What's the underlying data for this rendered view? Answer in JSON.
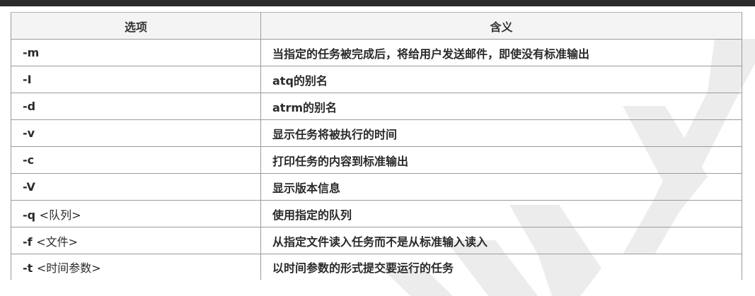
{
  "table": {
    "headers": [
      "选项",
      "含义"
    ],
    "rows": [
      {
        "option": "-m",
        "arg": "",
        "meaning": "当指定的任务被完成后，将给用户发送邮件，即使没有标准输出"
      },
      {
        "option": "-I",
        "arg": "",
        "meaning": "atq的别名"
      },
      {
        "option": "-d",
        "arg": "",
        "meaning": "atrm的别名"
      },
      {
        "option": "-v",
        "arg": "",
        "meaning": "显示任务将被执行的时间"
      },
      {
        "option": "-c",
        "arg": "",
        "meaning": "打印任务的内容到标准输出"
      },
      {
        "option": "-V",
        "arg": "",
        "meaning": "显示版本信息"
      },
      {
        "option": "-q",
        "arg": "<队列>",
        "meaning": "使用指定的队列"
      },
      {
        "option": "-f",
        "arg": "<文件>",
        "meaning": "从指定文件读入任务而不是从标准输入读入"
      },
      {
        "option": "-t",
        "arg": "<时间参数>",
        "meaning": "以时间参数的形式提交要运行的任务"
      }
    ]
  },
  "colors": {
    "border": "#9a9a9a",
    "header_bg": "#f4f4f4",
    "text": "#2a2a2a",
    "watermark": "#e6e6e6"
  }
}
